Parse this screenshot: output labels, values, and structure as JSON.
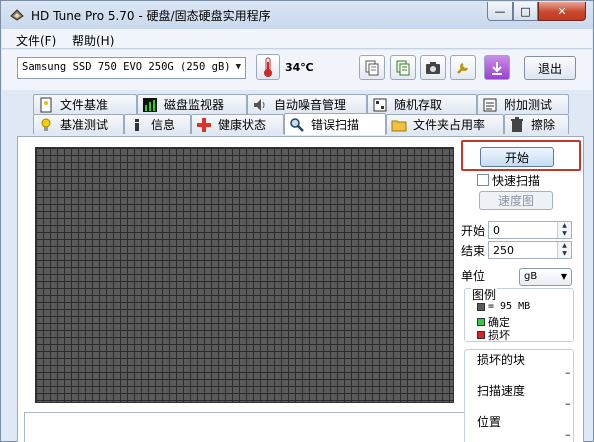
{
  "window": {
    "title": "HD Tune Pro 5.70 - 硬盘/固态硬盘实用程序",
    "min": "—",
    "max": "□",
    "close": "✕"
  },
  "menu": {
    "file": "文件(F)",
    "help": "帮助(H)"
  },
  "toolbar": {
    "drive": "Samsung SSD 750 EVO 250G (250 gB)",
    "temperature": "34℃",
    "exit": "退出",
    "icons": [
      "copy-info-icon",
      "copy-text-icon",
      "screenshot-icon",
      "options-icon",
      "download-icon"
    ]
  },
  "tabs_top": [
    {
      "label": "文件基准",
      "icon": "file-benchmark-icon"
    },
    {
      "label": "磁盘监视器",
      "icon": "disk-monitor-icon"
    },
    {
      "label": "自动噪音管理",
      "icon": "noise-icon"
    },
    {
      "label": "随机存取",
      "icon": "random-access-icon"
    },
    {
      "label": "附加测试",
      "icon": "extra-tests-icon"
    }
  ],
  "tabs_bottom": [
    {
      "label": "基准测试",
      "icon": "benchmark-icon"
    },
    {
      "label": "信息",
      "icon": "info-icon"
    },
    {
      "label": "健康状态",
      "icon": "health-icon"
    },
    {
      "label": "错误扫描",
      "icon": "error-scan-icon"
    },
    {
      "label": "文件夹占用率",
      "icon": "folder-usage-icon"
    },
    {
      "label": "擦除",
      "icon": "erase-icon"
    }
  ],
  "active_tab": "错误扫描",
  "scan": {
    "start_button": "开始",
    "quick_scan": "快速扫描",
    "quick_scan_checked": false,
    "speed_map": "速度图",
    "start_label": "开始",
    "start_value": "0",
    "end_label": "结束",
    "end_value": "250",
    "unit_label": "单位",
    "unit_value": "gB",
    "legend_title": "图例",
    "legend_block": "= 95 MB",
    "legend_ok": "确定",
    "legend_bad": "损坏",
    "bad_blocks_label": "损坏的块",
    "bad_blocks_value": "–",
    "scan_speed_label": "扫描速度",
    "scan_speed_value": "–",
    "position_label": "位置",
    "position_value": "–"
  },
  "colors": {
    "grid_block": "#5a5a5a",
    "ok": "#2ecc40",
    "bad": "#e02020",
    "highlight": "#c0392b"
  }
}
